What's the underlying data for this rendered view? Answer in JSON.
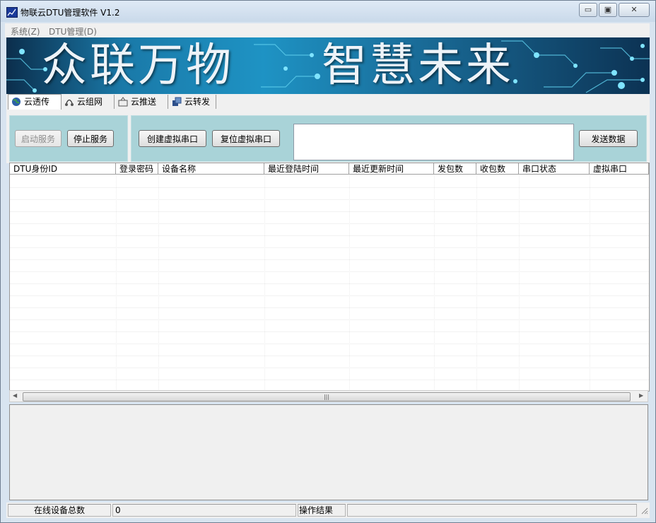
{
  "window": {
    "title": "物联云DTU管理软件 V1.2",
    "controls": {
      "min": "▭",
      "max": "▣",
      "close": "✕"
    }
  },
  "menu": [
    "系统(Z)",
    "DTU管理(D)"
  ],
  "banner": {
    "left_text": "众联万物",
    "right_text": "智慧未来"
  },
  "tabs": [
    {
      "label": "云透传",
      "icon": "globe-icon",
      "active": true
    },
    {
      "label": "云组网",
      "icon": "network-icon",
      "active": false
    },
    {
      "label": "云推送",
      "icon": "push-icon",
      "active": false
    },
    {
      "label": "云转发",
      "icon": "forward-icon",
      "active": false
    }
  ],
  "toolbar": {
    "start_label": "启动服务",
    "stop_label": "停止服务",
    "create_label": "创建虚拟串口",
    "reset_label": "复位虚拟串口",
    "send_label": "发送数据",
    "send_text": ""
  },
  "table": {
    "columns": [
      "DTU身份ID",
      "登录密码",
      "设备名称",
      "最近登陆时间",
      "最近更新时间",
      "发包数",
      "收包数",
      "串口状态",
      "虚拟串口"
    ],
    "rows": []
  },
  "log": {
    "text": ""
  },
  "status": {
    "online_label": "在线设备总数",
    "online_count": "0",
    "result_label": "操作结果",
    "result_value": ""
  },
  "colors": {
    "group_bg": "#a9d3d8",
    "banner_dark": "#0b2e4c",
    "banner_light": "#1e93c4"
  }
}
